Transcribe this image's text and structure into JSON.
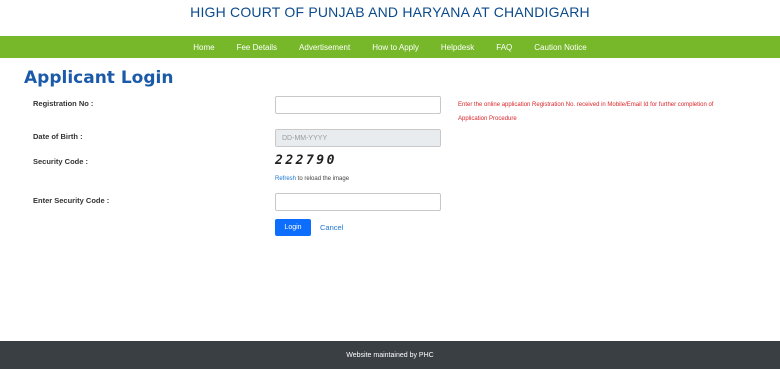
{
  "header": {
    "title": "HIGH COURT OF PUNJAB AND HARYANA AT CHANDIGARH"
  },
  "nav": {
    "items": [
      {
        "label": "Home"
      },
      {
        "label": "Fee Details"
      },
      {
        "label": "Advertisement"
      },
      {
        "label": "How to Apply"
      },
      {
        "label": "Helpdesk"
      },
      {
        "label": "FAQ"
      },
      {
        "label": "Caution Notice"
      }
    ]
  },
  "colors": {
    "brand_blue": "#1b5aa8",
    "nav_green": "#76b82a",
    "hint_red": "#d9262a",
    "button_blue": "#0d6efd",
    "footer_dark": "#3a3f44"
  },
  "form": {
    "heading": "Applicant Login",
    "registration_label": "Registration No :",
    "registration_value": "",
    "registration_hint": "Enter the online application Registration No. received in Mobile/Email Id for further completion of Application Procedure",
    "dob_label": "Date of Birth :",
    "dob_placeholder": "DD-MM-YYYY",
    "security_label": "Security Code :",
    "captcha_text": "222790",
    "refresh_link": "Refresh",
    "refresh_suffix": " to reload the image",
    "enter_security_label": "Enter Security Code :",
    "enter_security_value": "",
    "login_button": "Login",
    "cancel_link": "Cancel"
  },
  "footer": {
    "text": "Website maintained by PHC"
  }
}
